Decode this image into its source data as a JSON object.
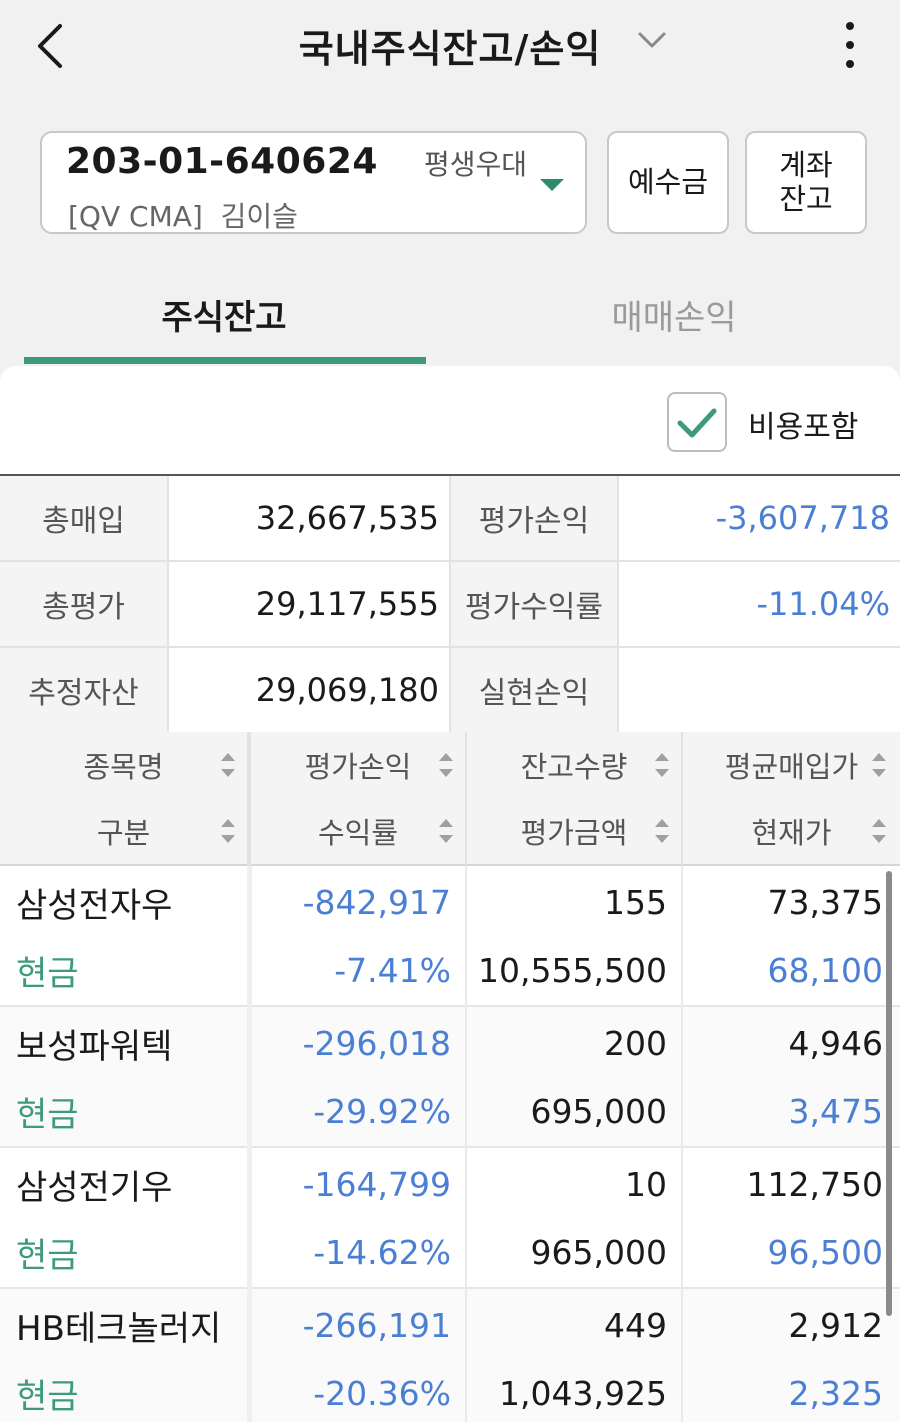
{
  "header": {
    "title": "국내주식잔고/손익"
  },
  "account": {
    "number": "203-01-640624",
    "type": "평생우대",
    "sub": "[QV CMA]  김이슬",
    "accent": "#2e8b6b"
  },
  "buttons": {
    "deposit": "예수금",
    "balance": "계좌\n잔고"
  },
  "tabs": [
    {
      "label": "주식잔고",
      "active": true
    },
    {
      "label": "매매손익",
      "active": false
    }
  ],
  "options": {
    "fee_include_label": "비용포함",
    "fee_include_checked": true
  },
  "summary": {
    "rows": [
      {
        "label1": "총매입",
        "value1": "32,667,535",
        "label2": "평가손익",
        "value2": "-3,607,718"
      },
      {
        "label1": "총평가",
        "value1": "29,117,555",
        "label2": "평가수익률",
        "value2": "-11.04%"
      },
      {
        "label1": "추정자산",
        "value1": "29,069,180",
        "label2": "실현손익",
        "value2": ""
      }
    ]
  },
  "grid": {
    "header_top": [
      "종목명",
      "평가손익",
      "잔고수량",
      "평균매입가"
    ],
    "header_bottom": [
      "구분",
      "수익률",
      "평가금액",
      "현재가"
    ],
    "rows": [
      {
        "name": "삼성전자우",
        "kind": "현금",
        "pl": "-842,917",
        "rate": "-7.41%",
        "qty": "155",
        "eval": "10,555,500",
        "avg": "73,375",
        "price": "68,100"
      },
      {
        "name": "보성파워텍",
        "kind": "현금",
        "pl": "-296,018",
        "rate": "-29.92%",
        "qty": "200",
        "eval": "695,000",
        "avg": "4,946",
        "price": "3,475"
      },
      {
        "name": "삼성전기우",
        "kind": "현금",
        "pl": "-164,799",
        "rate": "-14.62%",
        "qty": "10",
        "eval": "965,000",
        "avg": "112,750",
        "price": "96,500"
      },
      {
        "name": "HB테크놀러지",
        "kind": "현금",
        "pl": "-266,191",
        "rate": "-20.36%",
        "qty": "449",
        "eval": "1,043,925",
        "avg": "2,912",
        "price": "2,325"
      }
    ]
  },
  "colors": {
    "loss": "#4a7fd4",
    "green": "#3d9a7e"
  }
}
